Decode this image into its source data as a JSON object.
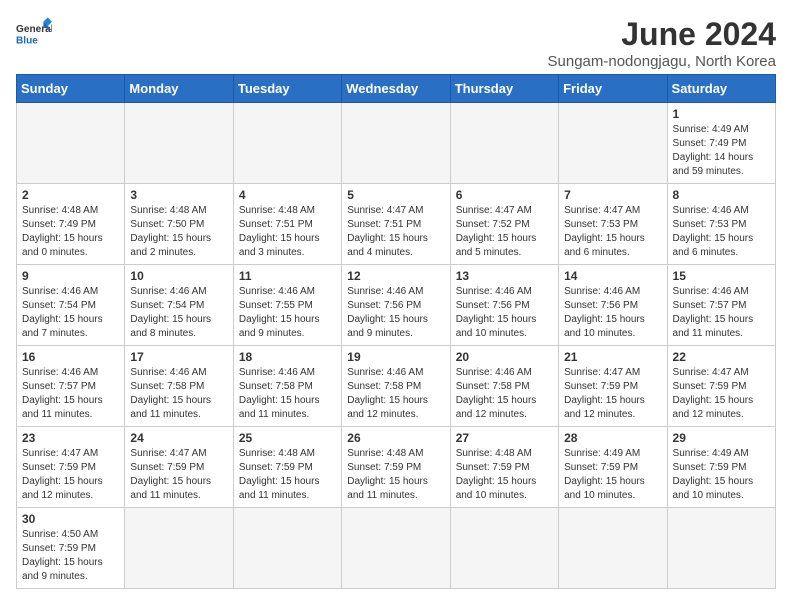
{
  "logo": {
    "text_general": "General",
    "text_blue": "Blue"
  },
  "title": "June 2024",
  "subtitle": "Sungam-nodongjagu, North Korea",
  "days_of_week": [
    "Sunday",
    "Monday",
    "Tuesday",
    "Wednesday",
    "Thursday",
    "Friday",
    "Saturday"
  ],
  "weeks": [
    [
      {
        "day": "",
        "info": ""
      },
      {
        "day": "",
        "info": ""
      },
      {
        "day": "",
        "info": ""
      },
      {
        "day": "",
        "info": ""
      },
      {
        "day": "",
        "info": ""
      },
      {
        "day": "",
        "info": ""
      },
      {
        "day": "1",
        "info": "Sunrise: 4:49 AM\nSunset: 7:49 PM\nDaylight: 14 hours\nand 59 minutes."
      }
    ],
    [
      {
        "day": "2",
        "info": "Sunrise: 4:48 AM\nSunset: 7:49 PM\nDaylight: 15 hours\nand 0 minutes."
      },
      {
        "day": "3",
        "info": "Sunrise: 4:48 AM\nSunset: 7:50 PM\nDaylight: 15 hours\nand 2 minutes."
      },
      {
        "day": "4",
        "info": "Sunrise: 4:48 AM\nSunset: 7:51 PM\nDaylight: 15 hours\nand 3 minutes."
      },
      {
        "day": "5",
        "info": "Sunrise: 4:47 AM\nSunset: 7:51 PM\nDaylight: 15 hours\nand 4 minutes."
      },
      {
        "day": "6",
        "info": "Sunrise: 4:47 AM\nSunset: 7:52 PM\nDaylight: 15 hours\nand 5 minutes."
      },
      {
        "day": "7",
        "info": "Sunrise: 4:47 AM\nSunset: 7:53 PM\nDaylight: 15 hours\nand 6 minutes."
      },
      {
        "day": "8",
        "info": "Sunrise: 4:46 AM\nSunset: 7:53 PM\nDaylight: 15 hours\nand 6 minutes."
      }
    ],
    [
      {
        "day": "9",
        "info": "Sunrise: 4:46 AM\nSunset: 7:54 PM\nDaylight: 15 hours\nand 7 minutes."
      },
      {
        "day": "10",
        "info": "Sunrise: 4:46 AM\nSunset: 7:54 PM\nDaylight: 15 hours\nand 8 minutes."
      },
      {
        "day": "11",
        "info": "Sunrise: 4:46 AM\nSunset: 7:55 PM\nDaylight: 15 hours\nand 9 minutes."
      },
      {
        "day": "12",
        "info": "Sunrise: 4:46 AM\nSunset: 7:56 PM\nDaylight: 15 hours\nand 9 minutes."
      },
      {
        "day": "13",
        "info": "Sunrise: 4:46 AM\nSunset: 7:56 PM\nDaylight: 15 hours\nand 10 minutes."
      },
      {
        "day": "14",
        "info": "Sunrise: 4:46 AM\nSunset: 7:56 PM\nDaylight: 15 hours\nand 10 minutes."
      },
      {
        "day": "15",
        "info": "Sunrise: 4:46 AM\nSunset: 7:57 PM\nDaylight: 15 hours\nand 11 minutes."
      }
    ],
    [
      {
        "day": "16",
        "info": "Sunrise: 4:46 AM\nSunset: 7:57 PM\nDaylight: 15 hours\nand 11 minutes."
      },
      {
        "day": "17",
        "info": "Sunrise: 4:46 AM\nSunset: 7:58 PM\nDaylight: 15 hours\nand 11 minutes."
      },
      {
        "day": "18",
        "info": "Sunrise: 4:46 AM\nSunset: 7:58 PM\nDaylight: 15 hours\nand 11 minutes."
      },
      {
        "day": "19",
        "info": "Sunrise: 4:46 AM\nSunset: 7:58 PM\nDaylight: 15 hours\nand 12 minutes."
      },
      {
        "day": "20",
        "info": "Sunrise: 4:46 AM\nSunset: 7:58 PM\nDaylight: 15 hours\nand 12 minutes."
      },
      {
        "day": "21",
        "info": "Sunrise: 4:47 AM\nSunset: 7:59 PM\nDaylight: 15 hours\nand 12 minutes."
      },
      {
        "day": "22",
        "info": "Sunrise: 4:47 AM\nSunset: 7:59 PM\nDaylight: 15 hours\nand 12 minutes."
      }
    ],
    [
      {
        "day": "23",
        "info": "Sunrise: 4:47 AM\nSunset: 7:59 PM\nDaylight: 15 hours\nand 12 minutes."
      },
      {
        "day": "24",
        "info": "Sunrise: 4:47 AM\nSunset: 7:59 PM\nDaylight: 15 hours\nand 11 minutes."
      },
      {
        "day": "25",
        "info": "Sunrise: 4:48 AM\nSunset: 7:59 PM\nDaylight: 15 hours\nand 11 minutes."
      },
      {
        "day": "26",
        "info": "Sunrise: 4:48 AM\nSunset: 7:59 PM\nDaylight: 15 hours\nand 11 minutes."
      },
      {
        "day": "27",
        "info": "Sunrise: 4:48 AM\nSunset: 7:59 PM\nDaylight: 15 hours\nand 10 minutes."
      },
      {
        "day": "28",
        "info": "Sunrise: 4:49 AM\nSunset: 7:59 PM\nDaylight: 15 hours\nand 10 minutes."
      },
      {
        "day": "29",
        "info": "Sunrise: 4:49 AM\nSunset: 7:59 PM\nDaylight: 15 hours\nand 10 minutes."
      }
    ],
    [
      {
        "day": "30",
        "info": "Sunrise: 4:50 AM\nSunset: 7:59 PM\nDaylight: 15 hours\nand 9 minutes."
      },
      {
        "day": "",
        "info": ""
      },
      {
        "day": "",
        "info": ""
      },
      {
        "day": "",
        "info": ""
      },
      {
        "day": "",
        "info": ""
      },
      {
        "day": "",
        "info": ""
      },
      {
        "day": "",
        "info": ""
      }
    ]
  ]
}
